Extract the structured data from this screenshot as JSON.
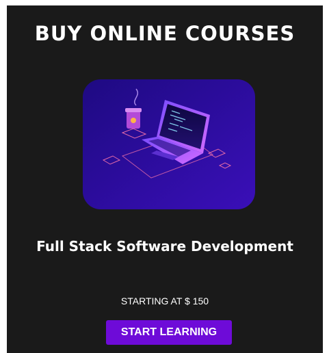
{
  "section": {
    "heading": "BUY ONLINE COURSES"
  },
  "course": {
    "image_icon": "laptop-coding-illustration-icon",
    "title": "Full Stack Software Development",
    "price_text": "STARTING AT $ 150",
    "button_label": "START LEARNING"
  },
  "colors": {
    "card_background": "#1a1a1a",
    "button_background": "#6e0bd8",
    "image_gradient_start": "#1e0a82",
    "image_gradient_end": "#3a0fb8"
  }
}
